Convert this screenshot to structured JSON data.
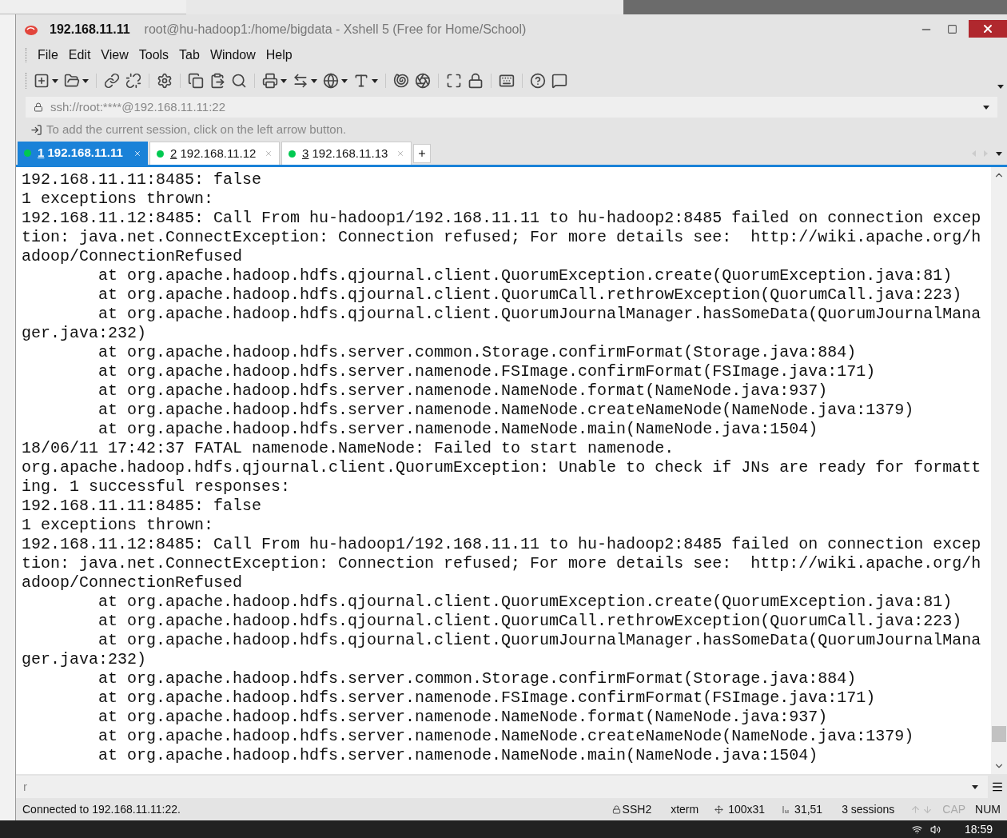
{
  "window": {
    "host": "192.168.11.11",
    "title": "root@hu-hadoop1:/home/bigdata - Xshell 5 (Free for Home/School)"
  },
  "menu": [
    "File",
    "Edit",
    "View",
    "Tools",
    "Tab",
    "Window",
    "Help"
  ],
  "address_bar": {
    "value": "ssh://root:****@192.168.11.11:22"
  },
  "hint_bar": {
    "text": "To add the current session, click on the left arrow button."
  },
  "tabs": [
    {
      "number": "1",
      "host": "192.168.11.11",
      "selected": true,
      "connected": true
    },
    {
      "number": "2",
      "host": "192.168.11.12",
      "selected": false,
      "connected": true
    },
    {
      "number": "3",
      "host": "192.168.11.13",
      "selected": false,
      "connected": true
    }
  ],
  "terminal": {
    "lines": [
      "192.168.11.11:8485: false",
      "1 exceptions thrown:",
      "192.168.11.12:8485: Call From hu-hadoop1/192.168.11.11 to hu-hadoop2:8485 failed on connection excep",
      "tion: java.net.ConnectException: Connection refused; For more details see:  http://wiki.apache.org/h",
      "adoop/ConnectionRefused",
      "        at org.apache.hadoop.hdfs.qjournal.client.QuorumException.create(QuorumException.java:81)",
      "        at org.apache.hadoop.hdfs.qjournal.client.QuorumCall.rethrowException(QuorumCall.java:223)",
      "        at org.apache.hadoop.hdfs.qjournal.client.QuorumJournalManager.hasSomeData(QuorumJournalMana",
      "ger.java:232)",
      "        at org.apache.hadoop.hdfs.server.common.Storage.confirmFormat(Storage.java:884)",
      "        at org.apache.hadoop.hdfs.server.namenode.FSImage.confirmFormat(FSImage.java:171)",
      "        at org.apache.hadoop.hdfs.server.namenode.NameNode.format(NameNode.java:937)",
      "        at org.apache.hadoop.hdfs.server.namenode.NameNode.createNameNode(NameNode.java:1379)",
      "        at org.apache.hadoop.hdfs.server.namenode.NameNode.main(NameNode.java:1504)",
      "18/06/11 17:42:37 FATAL namenode.NameNode: Failed to start namenode.",
      "org.apache.hadoop.hdfs.qjournal.client.QuorumException: Unable to check if JNs are ready for formatt",
      "ing. 1 successful responses:",
      "192.168.11.11:8485: false",
      "1 exceptions thrown:",
      "192.168.11.12:8485: Call From hu-hadoop1/192.168.11.11 to hu-hadoop2:8485 failed on connection excep",
      "tion: java.net.ConnectException: Connection refused; For more details see:  http://wiki.apache.org/h",
      "adoop/ConnectionRefused",
      "        at org.apache.hadoop.hdfs.qjournal.client.QuorumException.create(QuorumException.java:81)",
      "        at org.apache.hadoop.hdfs.qjournal.client.QuorumCall.rethrowException(QuorumCall.java:223)",
      "        at org.apache.hadoop.hdfs.qjournal.client.QuorumJournalManager.hasSomeData(QuorumJournalMana",
      "ger.java:232)",
      "        at org.apache.hadoop.hdfs.server.common.Storage.confirmFormat(Storage.java:884)",
      "        at org.apache.hadoop.hdfs.server.namenode.FSImage.confirmFormat(FSImage.java:171)",
      "        at org.apache.hadoop.hdfs.server.namenode.NameNode.format(NameNode.java:937)",
      "        at org.apache.hadoop.hdfs.server.namenode.NameNode.createNameNode(NameNode.java:1379)",
      "        at org.apache.hadoop.hdfs.server.namenode.NameNode.main(NameNode.java:1504)"
    ]
  },
  "compose_bar": {
    "value": "r"
  },
  "status_bar": {
    "message": "Connected to 192.168.11.11:22.",
    "protocol": "SSH2",
    "terminal_type": "xterm",
    "size": "100x31",
    "cursor": "31,51",
    "sessions": "3 sessions",
    "indicators": [
      {
        "label": "CAP",
        "on": false
      },
      {
        "label": "NUM",
        "on": true
      }
    ]
  },
  "taskbar": {
    "clock": "18:59"
  }
}
